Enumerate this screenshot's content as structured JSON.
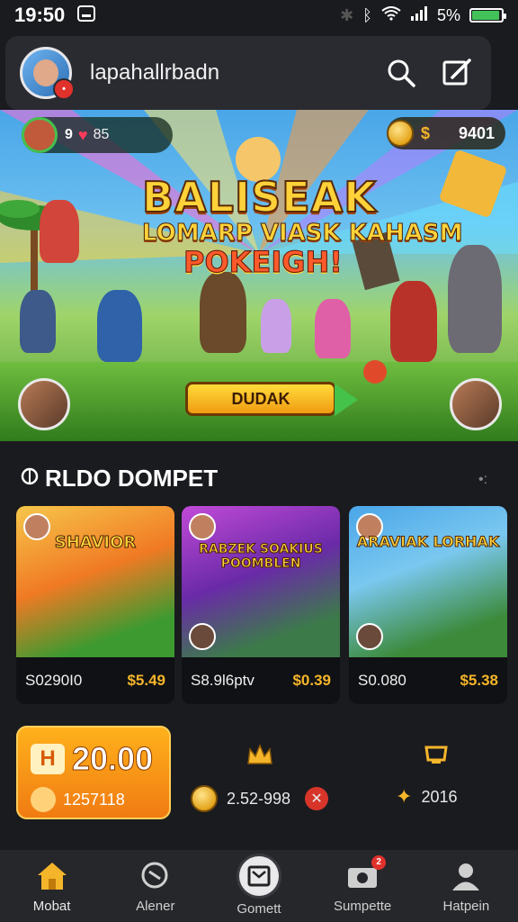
{
  "status": {
    "time": "19:50",
    "battery": "5%",
    "battery_color": "#43c25a"
  },
  "header": {
    "username": "lapahallrbadn",
    "search_icon": "search-icon",
    "edit_icon": "edit-icon"
  },
  "hero": {
    "level": "9",
    "hp_value": "85",
    "coins": "9401",
    "coin_symbol": "$",
    "title_line1": "BALISEAK",
    "title_line2": "LOMARP VIASK KAHASM",
    "title_line3": "POKEIGH!",
    "cta_label": "DUDAK"
  },
  "section": {
    "title": "RLDO DOMPET"
  },
  "cards": [
    {
      "title": "SHAVIOR",
      "code": "S0290I0",
      "price": "$5.49",
      "bg": "#f49a34"
    },
    {
      "title": "RABZEK SOAKIUS POOMBLEN",
      "code": "S8.9l6ptv",
      "price": "$0.39",
      "bg": "#9b46c8"
    },
    {
      "title": "ARAVIAK LORHAK",
      "code": "S0.080",
      "price": "$5.38",
      "bg": "#3b8ad8"
    }
  ],
  "promo": {
    "value": "20.00",
    "subtext": "1257118"
  },
  "stats": [
    {
      "value": "2.52-998",
      "icon": "coin-icon"
    },
    {
      "value": "2016",
      "icon": "star-icon"
    }
  ],
  "nav": [
    {
      "label": "Mobat",
      "icon": "home-icon"
    },
    {
      "label": "Alener",
      "icon": "search-icon"
    },
    {
      "label": "Gomett",
      "icon": "game-icon"
    },
    {
      "label": "Sumpette",
      "icon": "camera-icon",
      "badge": "2"
    },
    {
      "label": "Hatpein",
      "icon": "user-icon"
    }
  ]
}
